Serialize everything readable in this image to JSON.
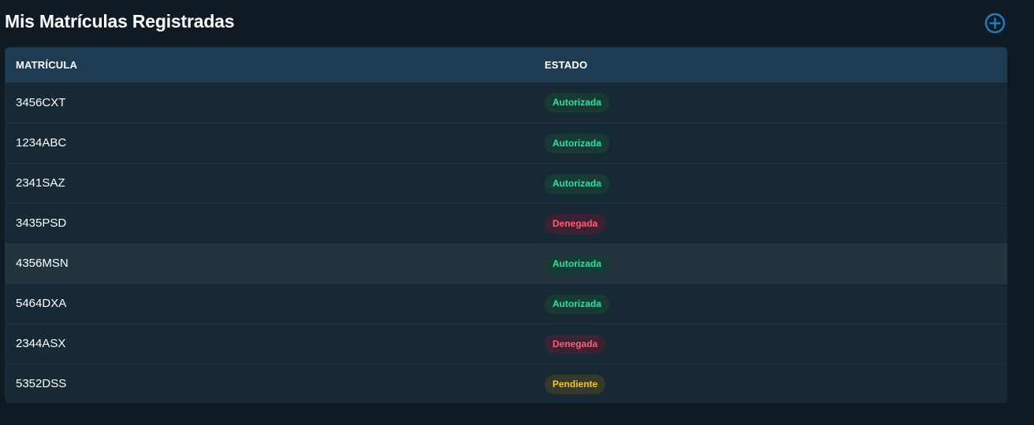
{
  "page": {
    "title": "Mis Matrículas Registradas",
    "add_button_icon": "plus-circle-icon",
    "accent_color": "#1e7fc2"
  },
  "table": {
    "headers": {
      "plate": "MATRÍCULA",
      "status": "ESTADO"
    },
    "rows": [
      {
        "plate": "3456CXT",
        "status": "Autorizada",
        "status_type": "ok"
      },
      {
        "plate": "1234ABC",
        "status": "Autorizada",
        "status_type": "ok"
      },
      {
        "plate": "2341SAZ",
        "status": "Autorizada",
        "status_type": "ok"
      },
      {
        "plate": "3435PSD",
        "status": "Denegada",
        "status_type": "no"
      },
      {
        "plate": "4356MSN",
        "status": "Autorizada",
        "status_type": "ok",
        "hovered": true
      },
      {
        "plate": "5464DXA",
        "status": "Autorizada",
        "status_type": "ok"
      },
      {
        "plate": "2344ASX",
        "status": "Denegada",
        "status_type": "no"
      },
      {
        "plate": "5352DSS",
        "status": "Pendiente",
        "status_type": "pend"
      }
    ]
  },
  "status_colors": {
    "ok": "#2ee0a0",
    "no": "#ff5b77",
    "pend": "#f1c531"
  }
}
